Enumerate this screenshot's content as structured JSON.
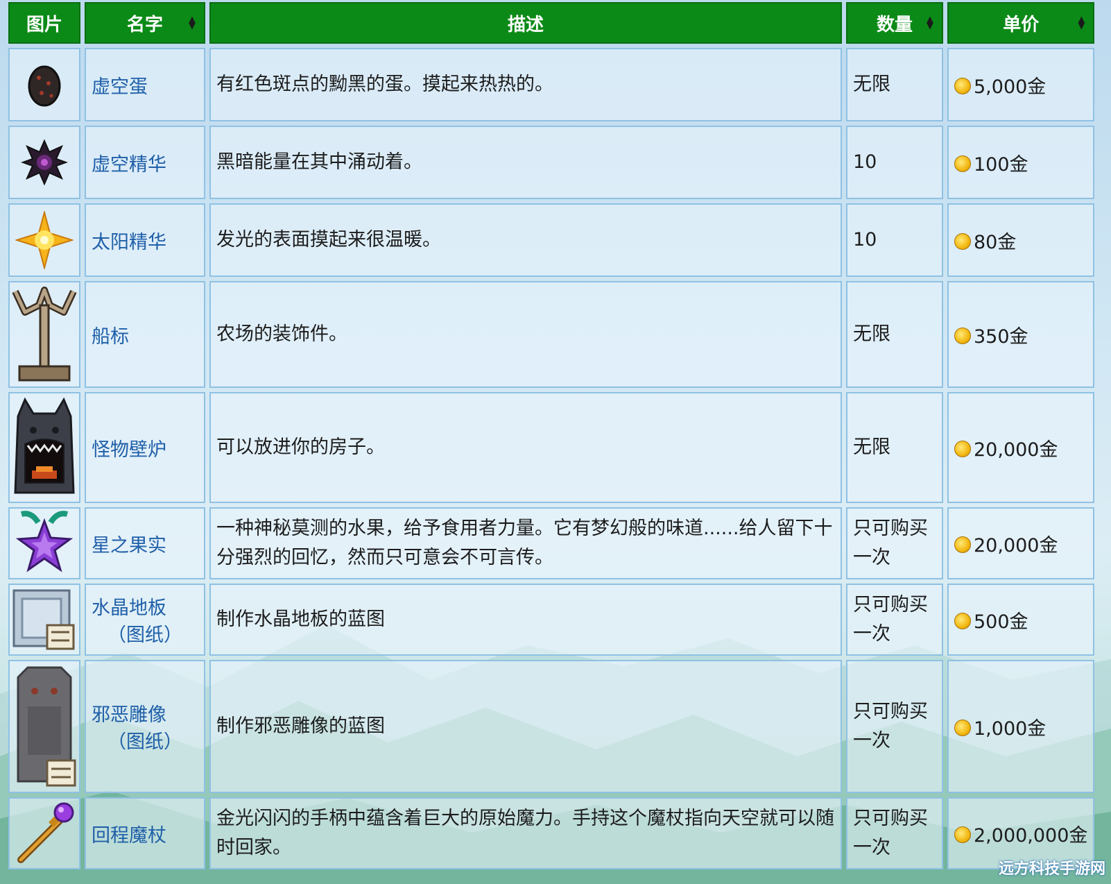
{
  "header": {
    "col_image": "图片",
    "col_name": "名字",
    "col_desc": "描述",
    "col_qty": "数量",
    "col_price": "单价"
  },
  "rows": [
    {
      "icon": "void-egg-icon",
      "name": "虚空蛋",
      "name_sub": "",
      "desc": "有红色斑点的黝黑的蛋。摸起来热热的。",
      "qty": "无限",
      "price": "5,000金"
    },
    {
      "icon": "void-essence-icon",
      "name": "虚空精华",
      "name_sub": "",
      "desc": "黑暗能量在其中涌动着。",
      "qty": "10",
      "price": "100金"
    },
    {
      "icon": "solar-essence-icon",
      "name": "太阳精华",
      "name_sub": "",
      "desc": "发光的表面摸起来很温暖。",
      "qty": "10",
      "price": "80金"
    },
    {
      "icon": "boat-sign-icon",
      "name": "船标",
      "name_sub": "",
      "desc": "农场的装饰件。",
      "qty": "无限",
      "price": "350金"
    },
    {
      "icon": "monster-fireplace-icon",
      "name": "怪物壁炉",
      "name_sub": "",
      "desc": "可以放进你的房子。",
      "qty": "无限",
      "price": "20,000金"
    },
    {
      "icon": "stardrop-icon",
      "name": "星之果实",
      "name_sub": "",
      "desc": "一种神秘莫测的水果，给予食用者力量。它有梦幻般的味道......给人留下十分强烈的回忆，然而只可意会不可言传。",
      "qty": "只可购买一次",
      "price": "20,000金"
    },
    {
      "icon": "crystal-floor-blueprint-icon",
      "name": "水晶地板",
      "name_sub": "（图纸）",
      "desc": "制作水晶地板的蓝图",
      "qty": "只可购买一次",
      "price": "500金"
    },
    {
      "icon": "evil-statue-blueprint-icon",
      "name": "邪恶雕像",
      "name_sub": "（图纸）",
      "desc": "制作邪恶雕像的蓝图",
      "qty": "只可购买一次",
      "price": "1,000金"
    },
    {
      "icon": "return-scepter-icon",
      "name": "回程魔杖",
      "name_sub": "",
      "desc": "金光闪闪的手柄中蕴含着巨大的原始魔力。手持这个魔杖指向天空就可以随时回家。",
      "qty": "只可购买一次",
      "price": "2,000,000金"
    }
  ],
  "watermark": "远方科技手游网",
  "colors": {
    "header_bg": "#0b8a17",
    "name_link": "#1f5fa8",
    "cell_border": "#8fc1e3"
  }
}
